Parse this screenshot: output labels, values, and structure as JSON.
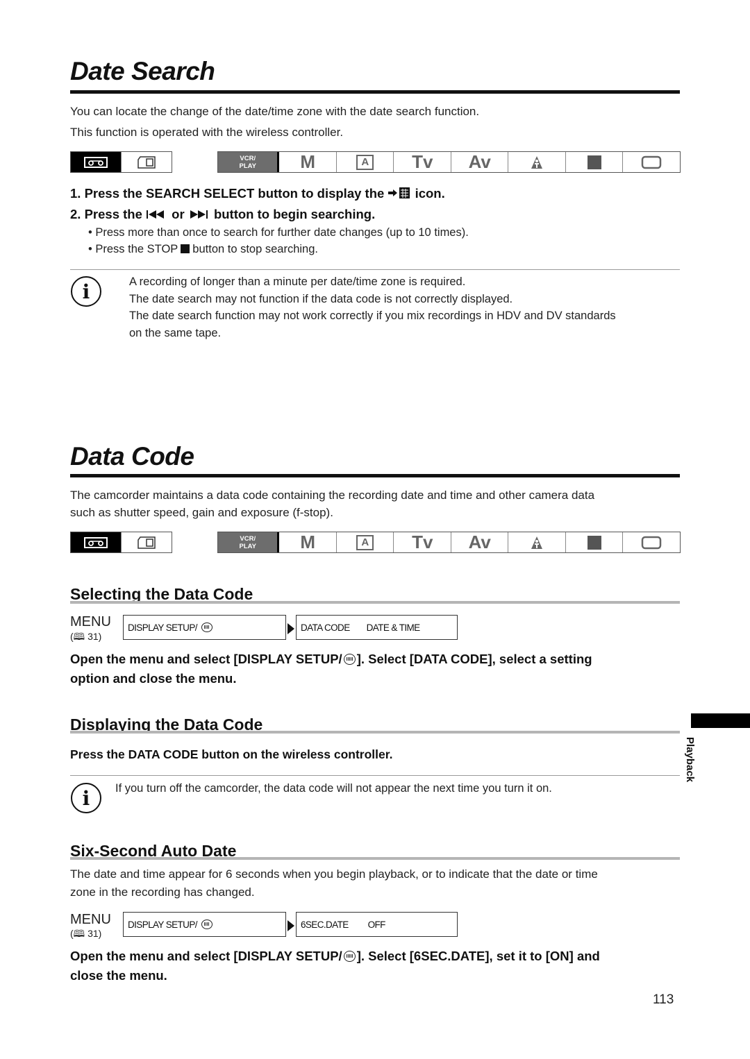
{
  "date_search": {
    "title": "Date Search",
    "intro": [
      "You can locate the change of the date/time zone with the date search function.",
      "This function is operated with the wireless controller."
    ],
    "steps": [
      {
        "num": "1.",
        "pre": "Press the SEARCH SELECT button to display the",
        "icon": "date-search-icon",
        "post": "icon."
      },
      {
        "num": "2.",
        "pre": "Press the",
        "icon_a": "skip-back-icon",
        "mid": "or",
        "icon_b": "skip-forward-icon",
        "post": "button to begin searching."
      }
    ],
    "bullets": [
      "Press more than once to search for further date changes (up to 10 times).",
      {
        "pre": "Press the STOP",
        "icon": "stop-icon",
        "post": "button to stop searching."
      }
    ],
    "notes": [
      "A recording of longer than a minute per date/time zone is required.",
      "The date search may not function if the data code is not correctly displayed.",
      "The date search function may not work correctly if you mix recordings in HDV and DV standards",
      "on the same tape."
    ]
  },
  "mode_bar": {
    "media": [
      {
        "name": "tape-icon",
        "active": true
      },
      {
        "name": "card-icon",
        "active": false
      }
    ],
    "vcr_play": [
      "VCR/",
      "PLAY"
    ],
    "modes": [
      "M",
      "A",
      "Tv",
      "Av",
      "portrait-icon",
      "night-icon",
      "easy-icon"
    ]
  },
  "data_code": {
    "title": "Data Code",
    "intro": [
      "The camcorder maintains a data code containing the recording date and time and other camera data",
      "such as shutter speed, gain and exposure (f-stop)."
    ],
    "selecting": {
      "heading": "Selecting the Data Code",
      "menu_label": "MENU",
      "menu_ref": "31",
      "menu_box1": "DISPLAY SETUP/",
      "menu_box2_item": "DATA CODE",
      "menu_box2_value": "DATE & TIME",
      "instruction_line1_pre": "Open the menu and select [DISPLAY SETUP/",
      "instruction_line1_post": "]. Select [DATA CODE], select a setting",
      "instruction_line2": "option and close the menu."
    },
    "displaying": {
      "heading": "Displaying the Data Code",
      "instruction": "Press the DATA CODE button on the wireless controller.",
      "note": "If you turn off the camcorder, the data code will not appear the next time you turn it on."
    },
    "six_second": {
      "heading": "Six-Second Auto Date",
      "intro": [
        "The date and time appear for 6 seconds when you begin playback, or to indicate that the date or time",
        "zone in the recording has changed."
      ],
      "menu_label": "MENU",
      "menu_ref": "31",
      "menu_box1": "DISPLAY SETUP/",
      "menu_box2_item": "6SEC.DATE",
      "menu_box2_value": "OFF",
      "instruction_line1_pre": "Open the menu and select [DISPLAY SETUP/",
      "instruction_line1_post": "]. Select [6SEC.DATE], set it to [ON] and",
      "instruction_line2": "close the menu."
    }
  },
  "side_tab": "Playback",
  "page_number": "113"
}
